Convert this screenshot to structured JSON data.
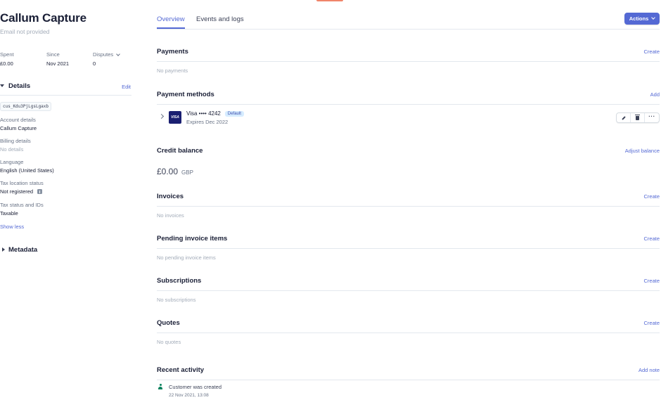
{
  "customer": {
    "name": "Callum Capture",
    "email": "Email not provided"
  },
  "stats": {
    "spent_label": "Spent",
    "spent_value": "£0.00",
    "since_label": "Since",
    "since_value": "Nov 2021",
    "disputes_label": "Disputes",
    "disputes_value": "0"
  },
  "details": {
    "title": "Details",
    "edit_label": "Edit",
    "customer_id": "cus_Kdu3PjLgsLgaxb",
    "fields": [
      {
        "label": "Account details",
        "value": "Callum Capture"
      },
      {
        "label": "Billing details",
        "value": "No details"
      },
      {
        "label": "Language",
        "value": "English (United States)"
      },
      {
        "label": "Tax location status",
        "value": "Not registered"
      },
      {
        "label": "Tax status and IDs",
        "value": "Taxable"
      }
    ],
    "show_less": "Show less"
  },
  "metadata": {
    "title": "Metadata"
  },
  "tabs": [
    {
      "label": "Overview",
      "active": true
    },
    {
      "label": "Events and logs",
      "active": false
    }
  ],
  "actions_button": {
    "label": "Actions"
  },
  "sections": {
    "payments": {
      "title": "Payments",
      "action": "Create",
      "empty": "No payments"
    },
    "payment_methods": {
      "title": "Payment methods",
      "action": "Add",
      "card": {
        "brand": "VISA",
        "label": "Visa •••• 4242",
        "badge": "Default",
        "expires": "Expires Dec 2022"
      }
    },
    "credit_balance": {
      "title": "Credit balance",
      "action": "Adjust balance",
      "amount": "£0.00",
      "currency": "GBP"
    },
    "invoices": {
      "title": "Invoices",
      "action": "Create",
      "empty": "No invoices"
    },
    "pending_invoice_items": {
      "title": "Pending invoice items",
      "action": "Create",
      "empty": "No pending invoice items"
    },
    "subscriptions": {
      "title": "Subscriptions",
      "action": "Create",
      "empty": "No subscriptions"
    },
    "quotes": {
      "title": "Quotes",
      "action": "Create",
      "empty": "No quotes"
    },
    "recent_activity": {
      "title": "Recent activity",
      "action": "Add note",
      "items": [
        {
          "text": "Customer was created",
          "time": "22 Nov 2021, 13:08"
        }
      ]
    }
  },
  "icons": {
    "edit": "pencil-icon",
    "delete": "trash-icon",
    "more": "more-icon",
    "info": "info-icon",
    "activity": "person-icon"
  },
  "colors": {
    "accent": "#5469d4",
    "text": "#1a1f36",
    "muted": "#a3acb9",
    "visa": "#1a1f71",
    "success": "#09825d"
  }
}
